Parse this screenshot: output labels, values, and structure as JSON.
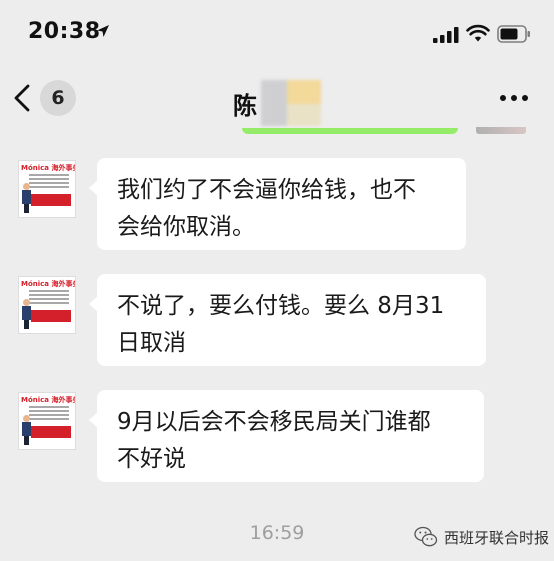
{
  "status_bar": {
    "time": "20:38",
    "icons": [
      "location-arrow-icon",
      "cellular-signal-icon",
      "wifi-icon",
      "battery-icon"
    ]
  },
  "nav": {
    "unread_count": "6",
    "title": "陈",
    "icons": [
      "back-chevron-icon",
      "more-dots-icon"
    ]
  },
  "messages": [
    {
      "sender": "contact",
      "avatar_label": "Mónica 海外事务所",
      "lines": [
        "我们约了不会逼你给钱，也不",
        "会给你取消。"
      ]
    },
    {
      "sender": "contact",
      "avatar_label": "Mónica 海外事务所",
      "lines": [
        "不说了，要么付钱。要么 8月31",
        "日取消"
      ]
    },
    {
      "sender": "contact",
      "avatar_label": "Mónica 海外事务所",
      "lines": [
        "9月以后会不会移民局关门谁都",
        "不好说"
      ]
    }
  ],
  "timestamp": "16:59",
  "watermark": {
    "icon": "wechat-logo-icon",
    "text": "西班牙联合时报"
  },
  "colors": {
    "background": "#ededed",
    "bubble": "#ffffff",
    "own_bubble": "#95ec69",
    "accent_red": "#d4202a",
    "timestamp_gray": "#9e9e9e"
  }
}
